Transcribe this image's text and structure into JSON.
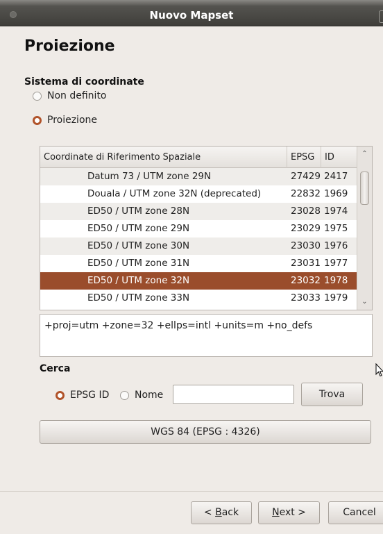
{
  "window": {
    "title": "Nuovo Mapset"
  },
  "page": {
    "title": "Proiezione"
  },
  "coordinate_system": {
    "label": "Sistema di coordinate",
    "options": [
      {
        "label": "Non definito",
        "selected": false
      },
      {
        "label": "Proiezione",
        "selected": true
      }
    ]
  },
  "table": {
    "headers": [
      "Coordinate di Riferimento Spaziale",
      "EPSG",
      "ID"
    ],
    "rows": [
      {
        "name": "Datum 73 / UTM zone 29N",
        "epsg": "27429",
        "id": "2417",
        "selected": false
      },
      {
        "name": "Douala / UTM zone 32N (deprecated)",
        "epsg": "22832",
        "id": "1969",
        "selected": false
      },
      {
        "name": "ED50 / UTM zone 28N",
        "epsg": "23028",
        "id": "1974",
        "selected": false
      },
      {
        "name": "ED50 / UTM zone 29N",
        "epsg": "23029",
        "id": "1975",
        "selected": false
      },
      {
        "name": "ED50 / UTM zone 30N",
        "epsg": "23030",
        "id": "1976",
        "selected": false
      },
      {
        "name": "ED50 / UTM zone 31N",
        "epsg": "23031",
        "id": "1977",
        "selected": false
      },
      {
        "name": "ED50 / UTM zone 32N",
        "epsg": "23032",
        "id": "1978",
        "selected": true
      },
      {
        "name": "ED50 / UTM zone 33N",
        "epsg": "23033",
        "id": "1979",
        "selected": false
      }
    ]
  },
  "proj_string": "+proj=utm +zone=32 +ellps=intl +units=m +no_defs",
  "search": {
    "label": "Cerca",
    "options": [
      {
        "label": "EPSG ID",
        "selected": true
      },
      {
        "label": "Nome",
        "selected": false
      }
    ],
    "value": "",
    "button": "Trova"
  },
  "current_crs_button": "WGS 84 (EPSG : 4326)",
  "footer": {
    "back": {
      "before": "< ",
      "mnemonic": "B",
      "after": "ack"
    },
    "next": {
      "mnemonic": "N",
      "after": "ext >"
    },
    "cancel": "Cancel"
  },
  "colors": {
    "accent": "#b1532a",
    "selection": "#9a4d2c",
    "titlebar": "#4a4945"
  }
}
